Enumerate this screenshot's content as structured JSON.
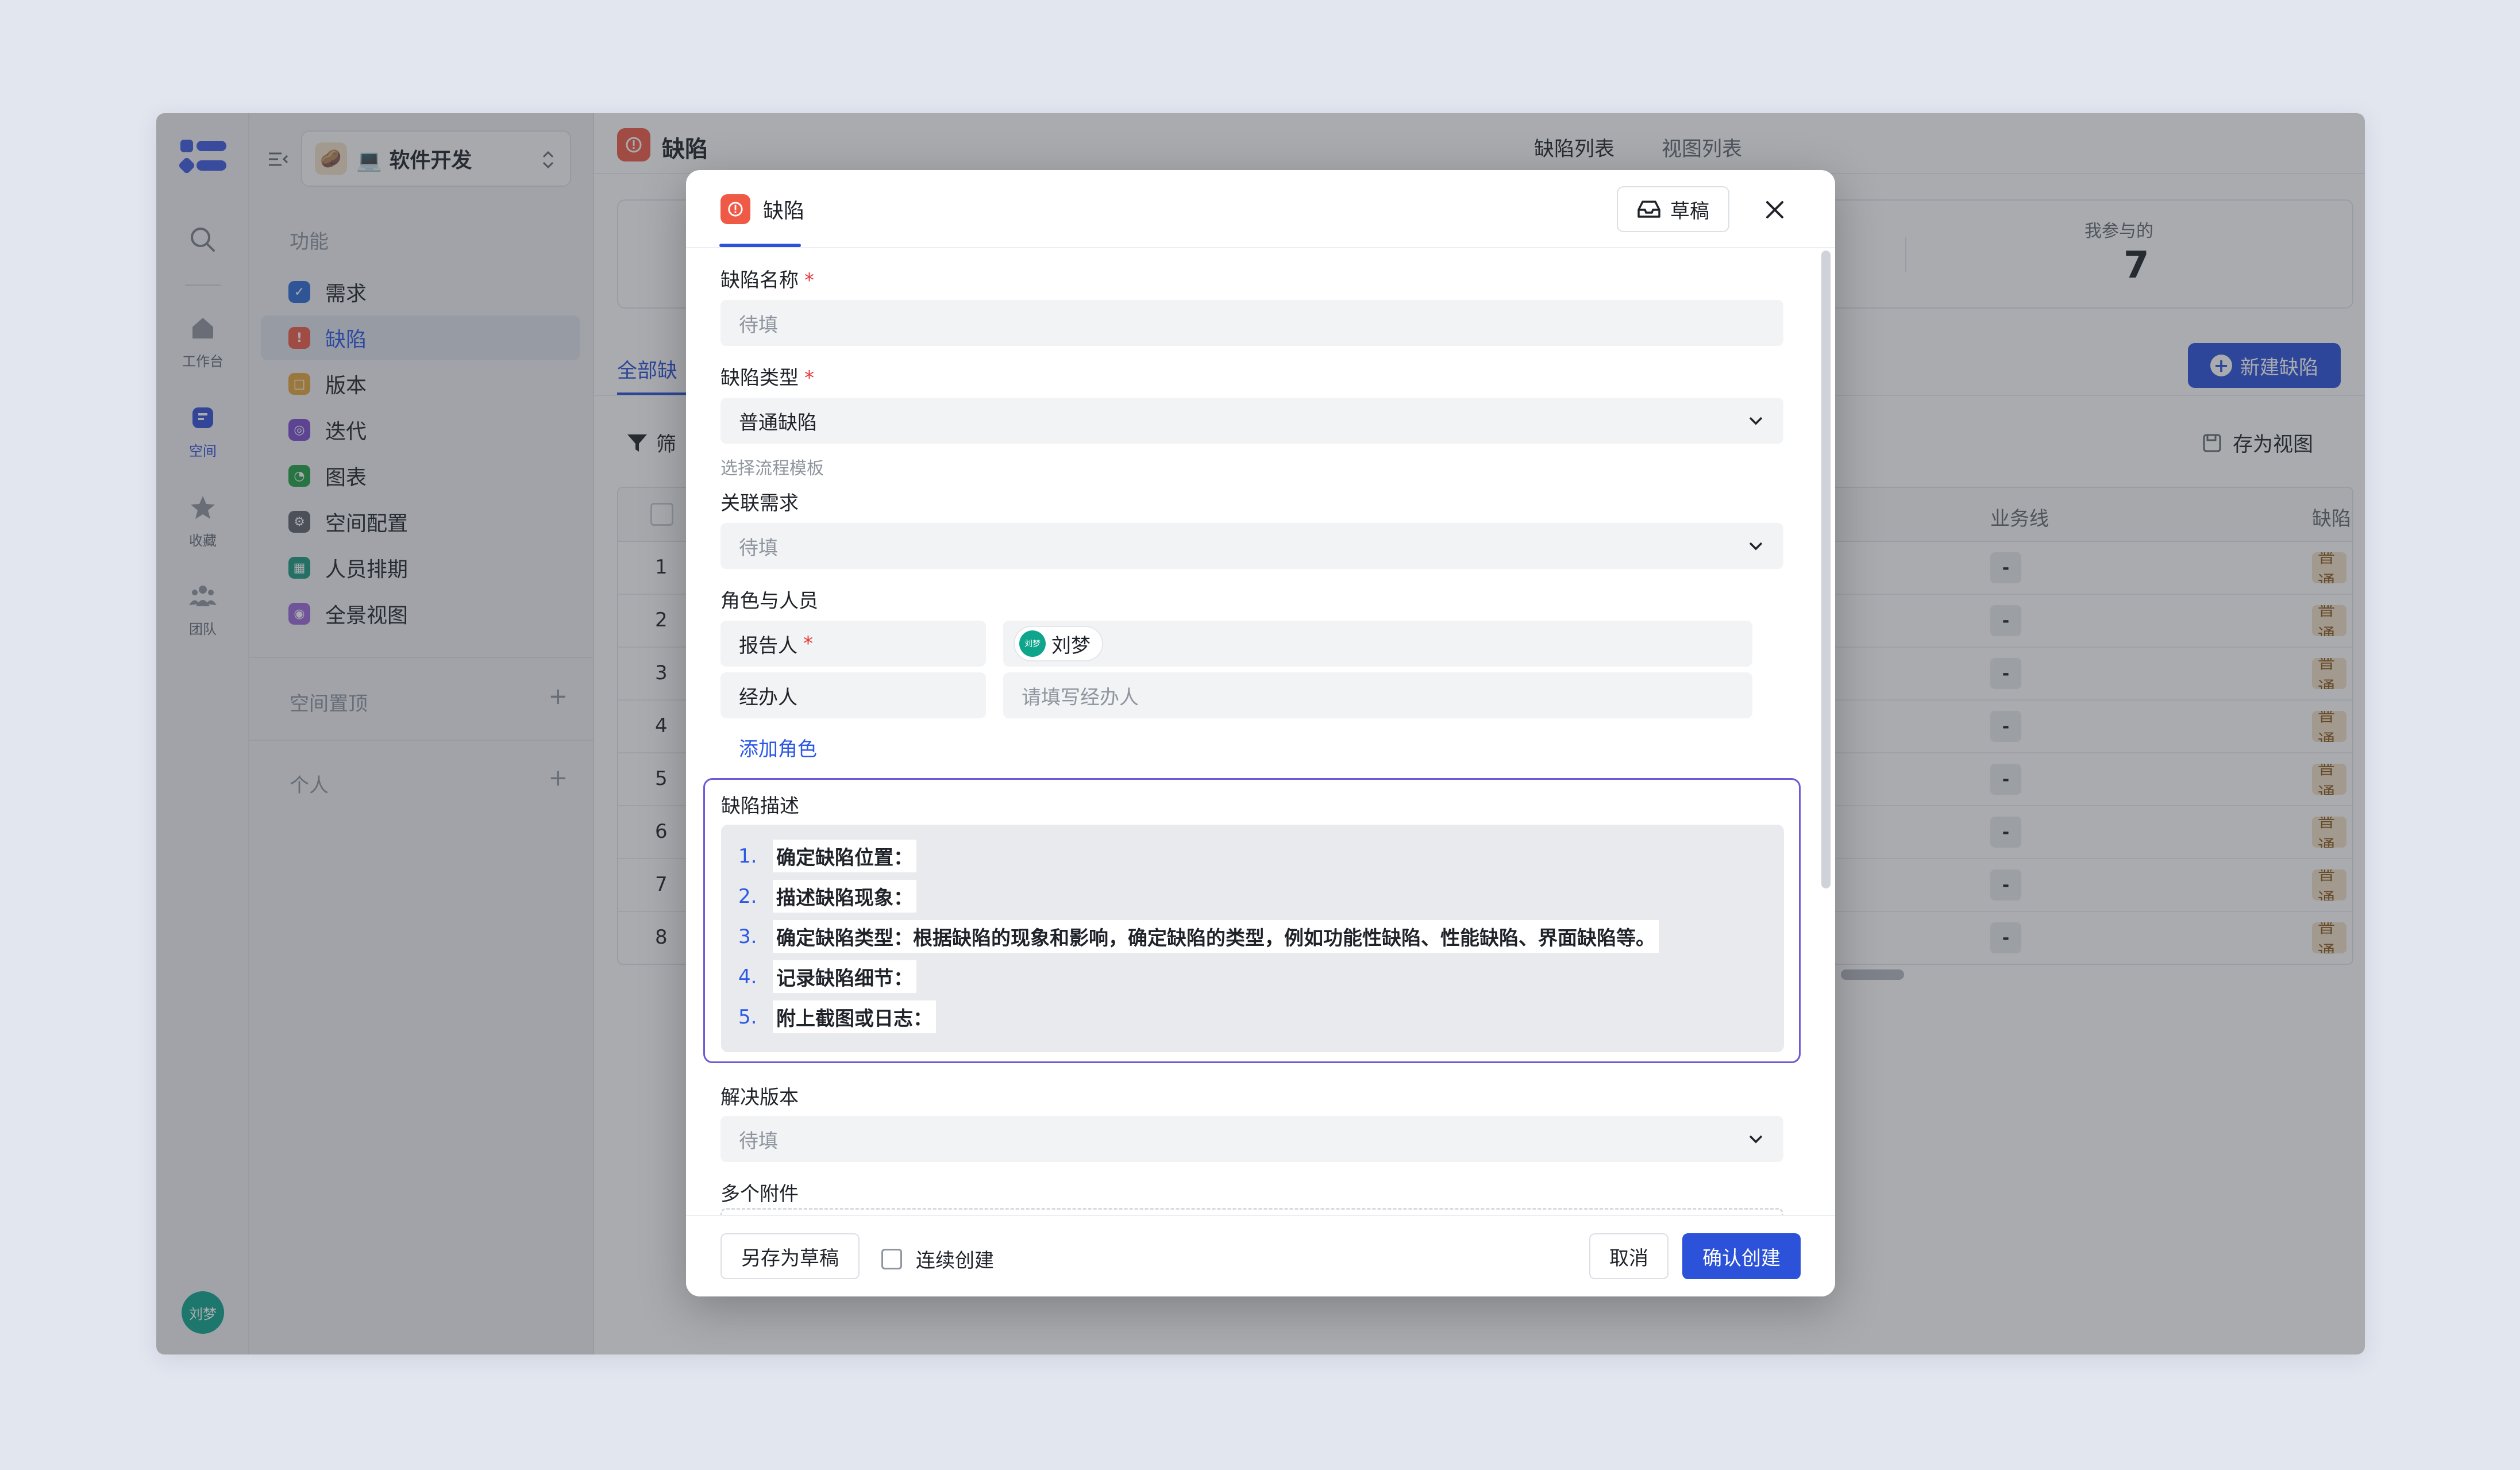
{
  "rail": {
    "items": [
      {
        "label": "工作台"
      },
      {
        "label": "空间"
      },
      {
        "label": "收藏"
      },
      {
        "label": "团队"
      }
    ],
    "avatar_text": "刘梦"
  },
  "sidenav": {
    "space_name": "💻 软件开发",
    "space_emoji": "🥔",
    "section_features": "功能",
    "items": [
      {
        "label": "需求",
        "color": "#2f6bd4"
      },
      {
        "label": "缺陷",
        "color": "#ef5a47"
      },
      {
        "label": "版本",
        "color": "#e6a53a"
      },
      {
        "label": "迭代",
        "color": "#7a4fcf"
      },
      {
        "label": "图表",
        "color": "#22a346"
      },
      {
        "label": "空间配置",
        "color": "#5d636c"
      },
      {
        "label": "人员排期",
        "color": "#1a9a7e"
      },
      {
        "label": "全景视图",
        "color": "#9c6ad9"
      }
    ],
    "section_pinned": "空间置顶",
    "section_personal": "个人"
  },
  "main": {
    "title": "缺陷",
    "tabs": [
      "缺陷列表",
      "视图列表"
    ],
    "stat_participating_label": "我参与的",
    "stat_participating_value": "7",
    "new_button": "新建缺陷",
    "view_tab_all": "全部缺",
    "filter_label": "筛",
    "save_view": "存为视图",
    "columns": [
      "业务线",
      "缺陷"
    ],
    "rows": [
      "1",
      "2",
      "3",
      "4",
      "5",
      "6",
      "7",
      "8"
    ],
    "dash": "-",
    "type_chip": "普通"
  },
  "modal": {
    "tab_label": "缺陷",
    "draft_button": "草稿",
    "fields": {
      "name_label": "缺陷名称",
      "name_placeholder": "待填",
      "type_label": "缺陷类型",
      "type_value": "普通缺陷",
      "type_helper": "选择流程模板",
      "related_label": "关联需求",
      "related_placeholder": "待填",
      "roles_label": "角色与人员",
      "reporter_label": "报告人",
      "reporter_value": "刘梦",
      "reporter_avatar": "刘梦",
      "assignee_label": "经办人",
      "assignee_placeholder": "请填写经办人",
      "add_role": "添加角色",
      "desc_label": "缺陷描述",
      "desc_items": [
        {
          "num": "1.",
          "text": "确定缺陷位置："
        },
        {
          "num": "2.",
          "text": "描述缺陷现象："
        },
        {
          "num": "3.",
          "text": "确定缺陷类型：根据缺陷的现象和影响，确定缺陷的类型，例如功能性缺陷、性能缺陷、界面缺陷等。"
        },
        {
          "num": "4.",
          "text": "记录缺陷细节："
        },
        {
          "num": "5.",
          "text": "附上截图或日志："
        }
      ],
      "version_label": "解决版本",
      "version_placeholder": "待填",
      "attachments_label": "多个附件"
    },
    "footer": {
      "save_draft": "另存为草稿",
      "continuous_create": "连续创建",
      "cancel": "取消",
      "confirm": "确认创建"
    }
  }
}
